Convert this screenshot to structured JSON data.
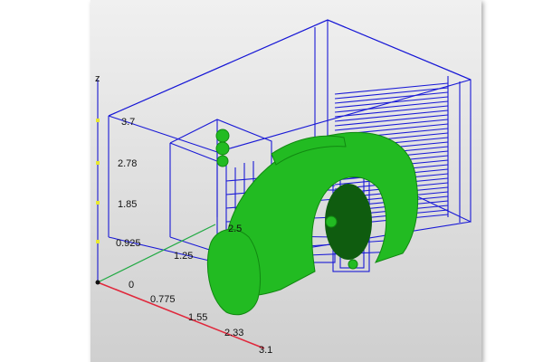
{
  "colors": {
    "background_top": "#f0f0f0",
    "background_bottom": "#cfcfcf",
    "wireframe": "#1a1ad6",
    "mesh": "#22bb22",
    "x_axis": "#e0283c",
    "y_axis": "#22aa44",
    "z_axis": "#2a2ad0",
    "z_tick_marks": "#e8e830"
  },
  "axes": {
    "z_label": "z",
    "z_ticks": [
      "3.7",
      "2.78",
      "1.85",
      "0.925"
    ],
    "x_ticks": [
      "0",
      "0.775",
      "1.55",
      "2.33",
      "3.1"
    ],
    "y_ticks": [
      "1.25",
      "2.5"
    ]
  }
}
